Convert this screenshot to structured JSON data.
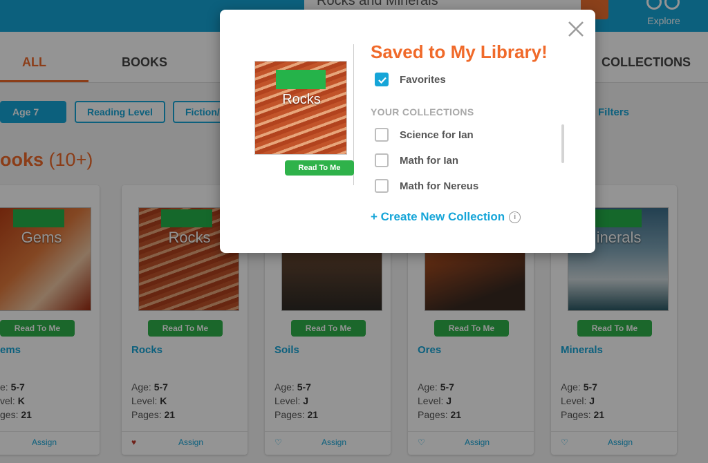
{
  "header": {
    "search_value": "Rocks and Minerals",
    "explore_label": "Explore"
  },
  "tabs": [
    {
      "label": "ALL",
      "active": true
    },
    {
      "label": "BOOKS",
      "active": false
    },
    {
      "label": "COLLECTIONS",
      "active": false
    }
  ],
  "filters": {
    "chips": [
      "Age 7",
      "Reading Level",
      "Fiction/"
    ],
    "clear_label": "r Filters"
  },
  "section": {
    "title": "ooks",
    "count": "(10+)"
  },
  "cards": [
    {
      "cover_title": "Gems",
      "title": "ems",
      "age_label": "e:",
      "age": "5-7",
      "level_label": "vel:",
      "level": "K",
      "pages_label": "ges:",
      "pages": "21",
      "rtm": "Read To Me",
      "assign": "Assign",
      "favorited": false
    },
    {
      "cover_title": "Rocks",
      "title": "Rocks",
      "age_label": "Age:",
      "age": "5-7",
      "level_label": "Level:",
      "level": "K",
      "pages_label": "Pages:",
      "pages": "21",
      "rtm": "Read To Me",
      "assign": "Assign",
      "favorited": true
    },
    {
      "cover_title": "",
      "title": "Soils",
      "age_label": "Age:",
      "age": "5-7",
      "level_label": "Level:",
      "level": "J",
      "pages_label": "Pages:",
      "pages": "21",
      "rtm": "Read To Me",
      "assign": "Assign",
      "favorited": false
    },
    {
      "cover_title": "",
      "title": "Ores",
      "age_label": "Age:",
      "age": "5-7",
      "level_label": "Level:",
      "level": "J",
      "pages_label": "Pages:",
      "pages": "21",
      "rtm": "Read To Me",
      "assign": "Assign",
      "favorited": false
    },
    {
      "cover_title": "inerals",
      "title": "Minerals",
      "age_label": "Age:",
      "age": "5-7",
      "level_label": "Level:",
      "level": "J",
      "pages_label": "Pages:",
      "pages": "21",
      "rtm": "Read To Me",
      "assign": "Assign",
      "favorited": false
    }
  ],
  "modal": {
    "title": "Saved to My Library!",
    "book_cover_title": "Rocks",
    "read_to_me": "Read To Me",
    "favorites": {
      "label": "Favorites",
      "checked": true
    },
    "collections_heading": "YOUR COLLECTIONS",
    "collections": [
      {
        "label": "Science for Ian",
        "checked": false
      },
      {
        "label": "Math for Ian",
        "checked": false
      },
      {
        "label": "Math for Nereus",
        "checked": false
      }
    ],
    "create_link": "+ Create New Collection"
  },
  "colors": {
    "brand_blue": "#16a5d8",
    "accent_orange": "#f06a2a",
    "read_green": "#2fb24a"
  }
}
